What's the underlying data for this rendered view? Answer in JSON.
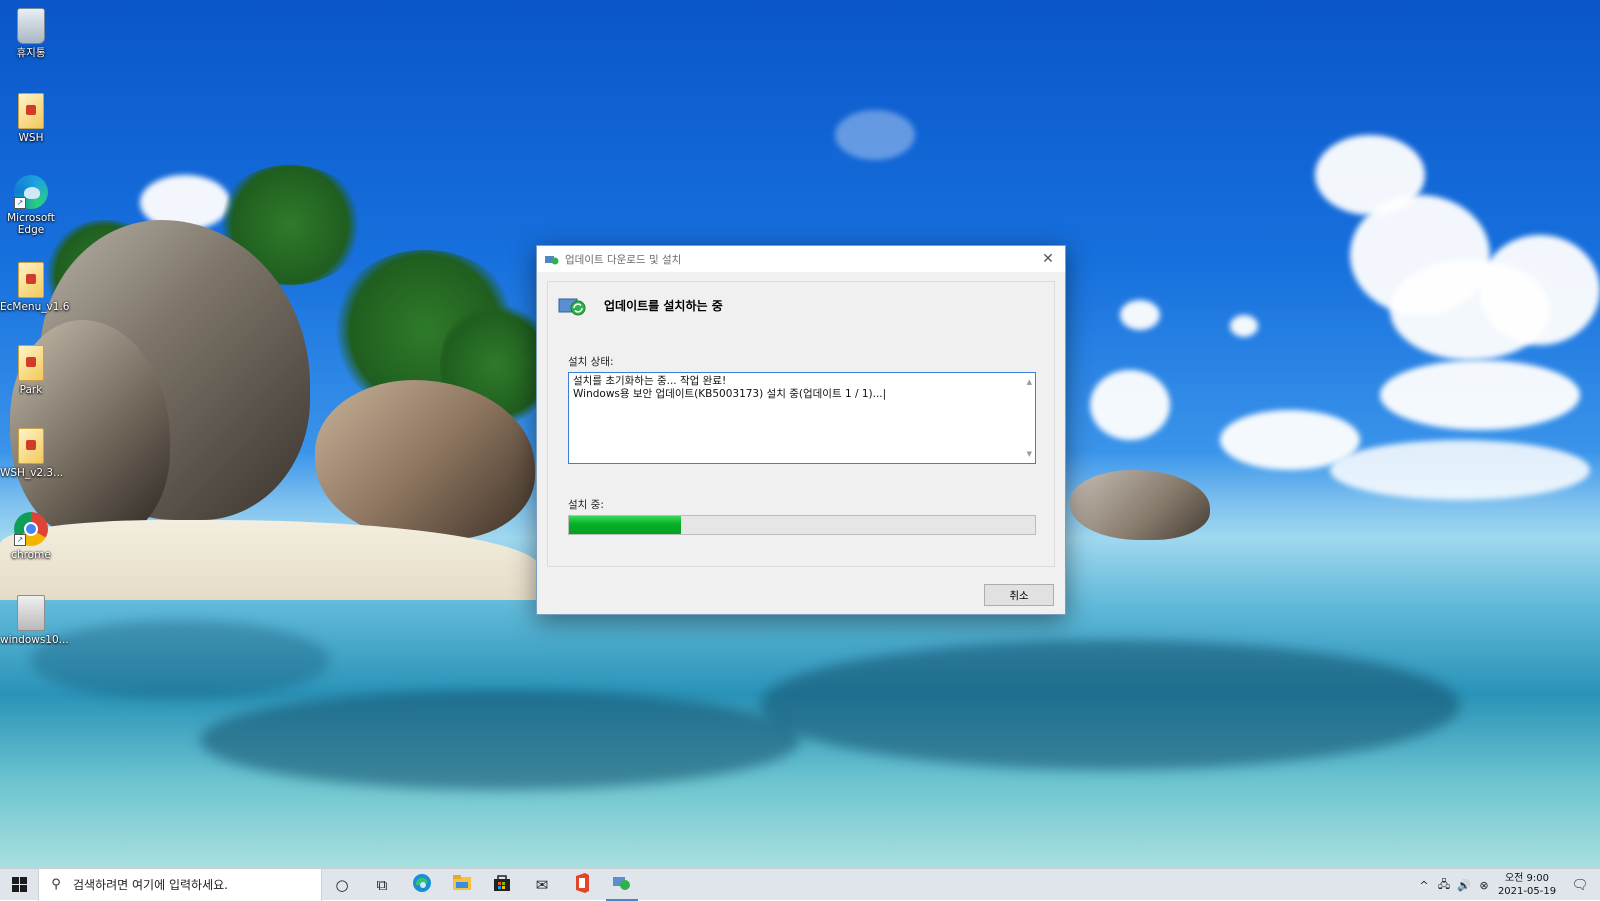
{
  "desktop": {
    "icons": [
      {
        "label": "휴지통",
        "icon": "recycle-bin-icon"
      },
      {
        "label": "WSH",
        "icon": "file-icon"
      },
      {
        "label": "Microsoft Edge",
        "icon": "edge-icon"
      },
      {
        "label": "EcMenu_v1.6",
        "icon": "file-icon"
      },
      {
        "label": "Park",
        "icon": "file-icon"
      },
      {
        "label": "WSH_v2.3...",
        "icon": "file-icon"
      },
      {
        "label": "chrome",
        "icon": "chrome-icon"
      },
      {
        "label": "windows10...",
        "icon": "setup-icon"
      }
    ]
  },
  "dialog": {
    "title": "업데이트 다운로드 및 설치",
    "close_glyph": "✕",
    "heading": "업데이트를 설치하는 중",
    "status_label": "설치 상태:",
    "log_lines": [
      "설치를 초기화하는 중... 작업 완료!",
      "Windows용 보안 업데이트(KB5003173) 설치 중(업데이트 1 / 1)..."
    ],
    "progress_label": "설치 중:",
    "progress_fraction": 0.24,
    "progress_color": "#06b025",
    "cancel_label": "취소"
  },
  "taskbar": {
    "search_placeholder": "검색하려면 여기에 입력하세요.",
    "search_glyph": "⚲",
    "pinned": [
      {
        "icon": "cortana-icon",
        "glyph": "○"
      },
      {
        "icon": "task-view-icon",
        "glyph": "⧉"
      },
      {
        "icon": "edge-icon",
        "glyph": ""
      },
      {
        "icon": "file-explorer-icon",
        "glyph": ""
      },
      {
        "icon": "store-icon",
        "glyph": ""
      },
      {
        "icon": "mail-icon",
        "glyph": "✉"
      },
      {
        "icon": "office-icon",
        "glyph": ""
      },
      {
        "icon": "windows-update-icon",
        "glyph": ""
      }
    ],
    "tray": {
      "chevron": "^",
      "network": "🖧",
      "volume": "🔊",
      "status": "⊗",
      "time": "오전 9:00",
      "date": "2021-05-19",
      "notification": "🗨"
    }
  }
}
